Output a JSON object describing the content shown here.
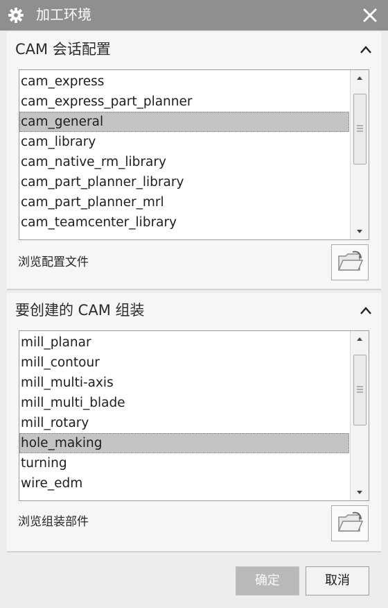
{
  "window": {
    "title": "加工环境",
    "icon": "gear-icon",
    "close_icon": "close-icon"
  },
  "session_config": {
    "header": "CAM 会话配置",
    "items": [
      "cam_express",
      "cam_express_part_planner",
      "cam_general",
      "cam_library",
      "cam_native_rm_library",
      "cam_part_planner_library",
      "cam_part_planner_mrl",
      "cam_teamcenter_library"
    ],
    "selected": "cam_general",
    "browse_label": "浏览配置文件"
  },
  "setup": {
    "header": "要创建的 CAM 组装",
    "items": [
      "mill_planar",
      "mill_contour",
      "mill_multi-axis",
      "mill_multi_blade",
      "mill_rotary",
      "hole_making",
      "turning",
      "wire_edm"
    ],
    "selected": "hole_making",
    "browse_label": "浏览组装部件"
  },
  "buttons": {
    "ok": "确定",
    "cancel": "取消"
  },
  "colors": {
    "titlebar": "#8f8f8f",
    "selection": "#c4c4c4",
    "ok_disabled": "#b9b9b9"
  }
}
